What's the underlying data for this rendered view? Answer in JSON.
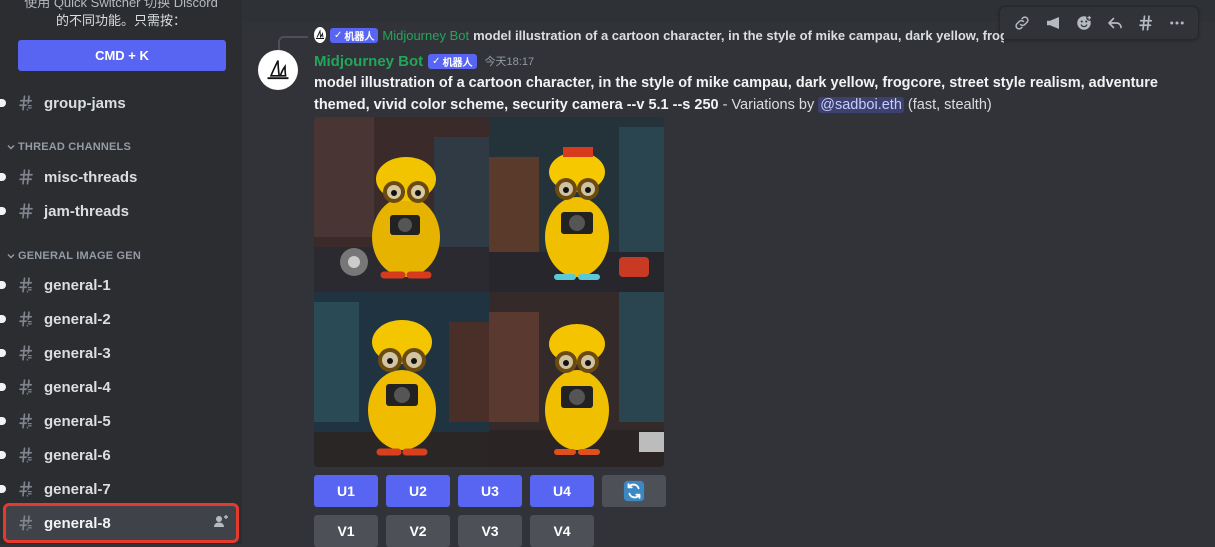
{
  "sidebar": {
    "hint_line1": "使用 Quick Switcher 切换 Discord",
    "hint_line2": "的不同功能。只需按：",
    "cmdk_label": "CMD + K",
    "channels_top": [
      {
        "label": "group-jams"
      }
    ],
    "categories": [
      {
        "label": "THREAD CHANNELS",
        "channels": [
          {
            "label": "misc-threads"
          },
          {
            "label": "jam-threads"
          }
        ]
      },
      {
        "label": "GENERAL IMAGE GEN",
        "channels": [
          {
            "label": "general-1"
          },
          {
            "label": "general-2"
          },
          {
            "label": "general-3"
          },
          {
            "label": "general-4"
          },
          {
            "label": "general-5"
          },
          {
            "label": "general-6"
          },
          {
            "label": "general-7"
          },
          {
            "label": "general-8"
          }
        ]
      }
    ]
  },
  "message": {
    "reply": {
      "bot_tag": "机器人",
      "author": "Midjourney Bot",
      "text": "model illustration of a cartoon character, in the style of mike campau, dark yellow, frogcore, street style realism,"
    },
    "author": "Midjourney Bot",
    "bot_tag": "机器人",
    "timestamp": "今天18:17",
    "prompt_line": "model illustration of a cartoon character, in the style of mike campau, dark yellow, frogcore, street style realism, adventure themed, vivid color scheme, security camera --v 5.1 --s 250",
    "variations_text": " - Variations by ",
    "mention": "@sadboi.eth",
    "mode_text": " (fast, stealth)"
  },
  "buttons": {
    "upscale": [
      "U1",
      "U2",
      "U3",
      "U4"
    ],
    "variation": [
      "V1",
      "V2",
      "V3",
      "V4"
    ],
    "reroll_icon": "refresh-icon"
  },
  "toolbar": {
    "icons": [
      "link-icon",
      "mute-icon",
      "add-reaction-icon",
      "reply-icon",
      "thread-icon",
      "more-icon"
    ]
  },
  "colors": {
    "accent": "#5865f2",
    "bot_green": "#23a55a",
    "highlight_outline": "#e53a2b"
  }
}
